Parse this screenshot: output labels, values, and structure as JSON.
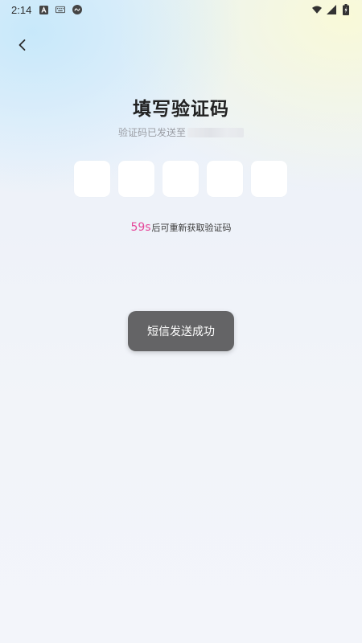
{
  "status_bar": {
    "time": "2:14",
    "left_icons": [
      "font-a-icon",
      "keyboard-icon",
      "link-app-icon"
    ],
    "right_icons": [
      "wifi-icon",
      "signal-icon",
      "battery-charging-icon"
    ]
  },
  "header": {
    "back_icon": "chevron-left-icon"
  },
  "page": {
    "title": "填写验证码",
    "subtitle": "验证码已发送至"
  },
  "code_input": {
    "length": 5
  },
  "resend": {
    "countdown": "59s",
    "text": "后可重新获取验证码"
  },
  "toast": {
    "message": "短信发送成功"
  },
  "colors": {
    "accent": "#e6489a",
    "toast_bg": "#646466",
    "title": "#222222"
  }
}
